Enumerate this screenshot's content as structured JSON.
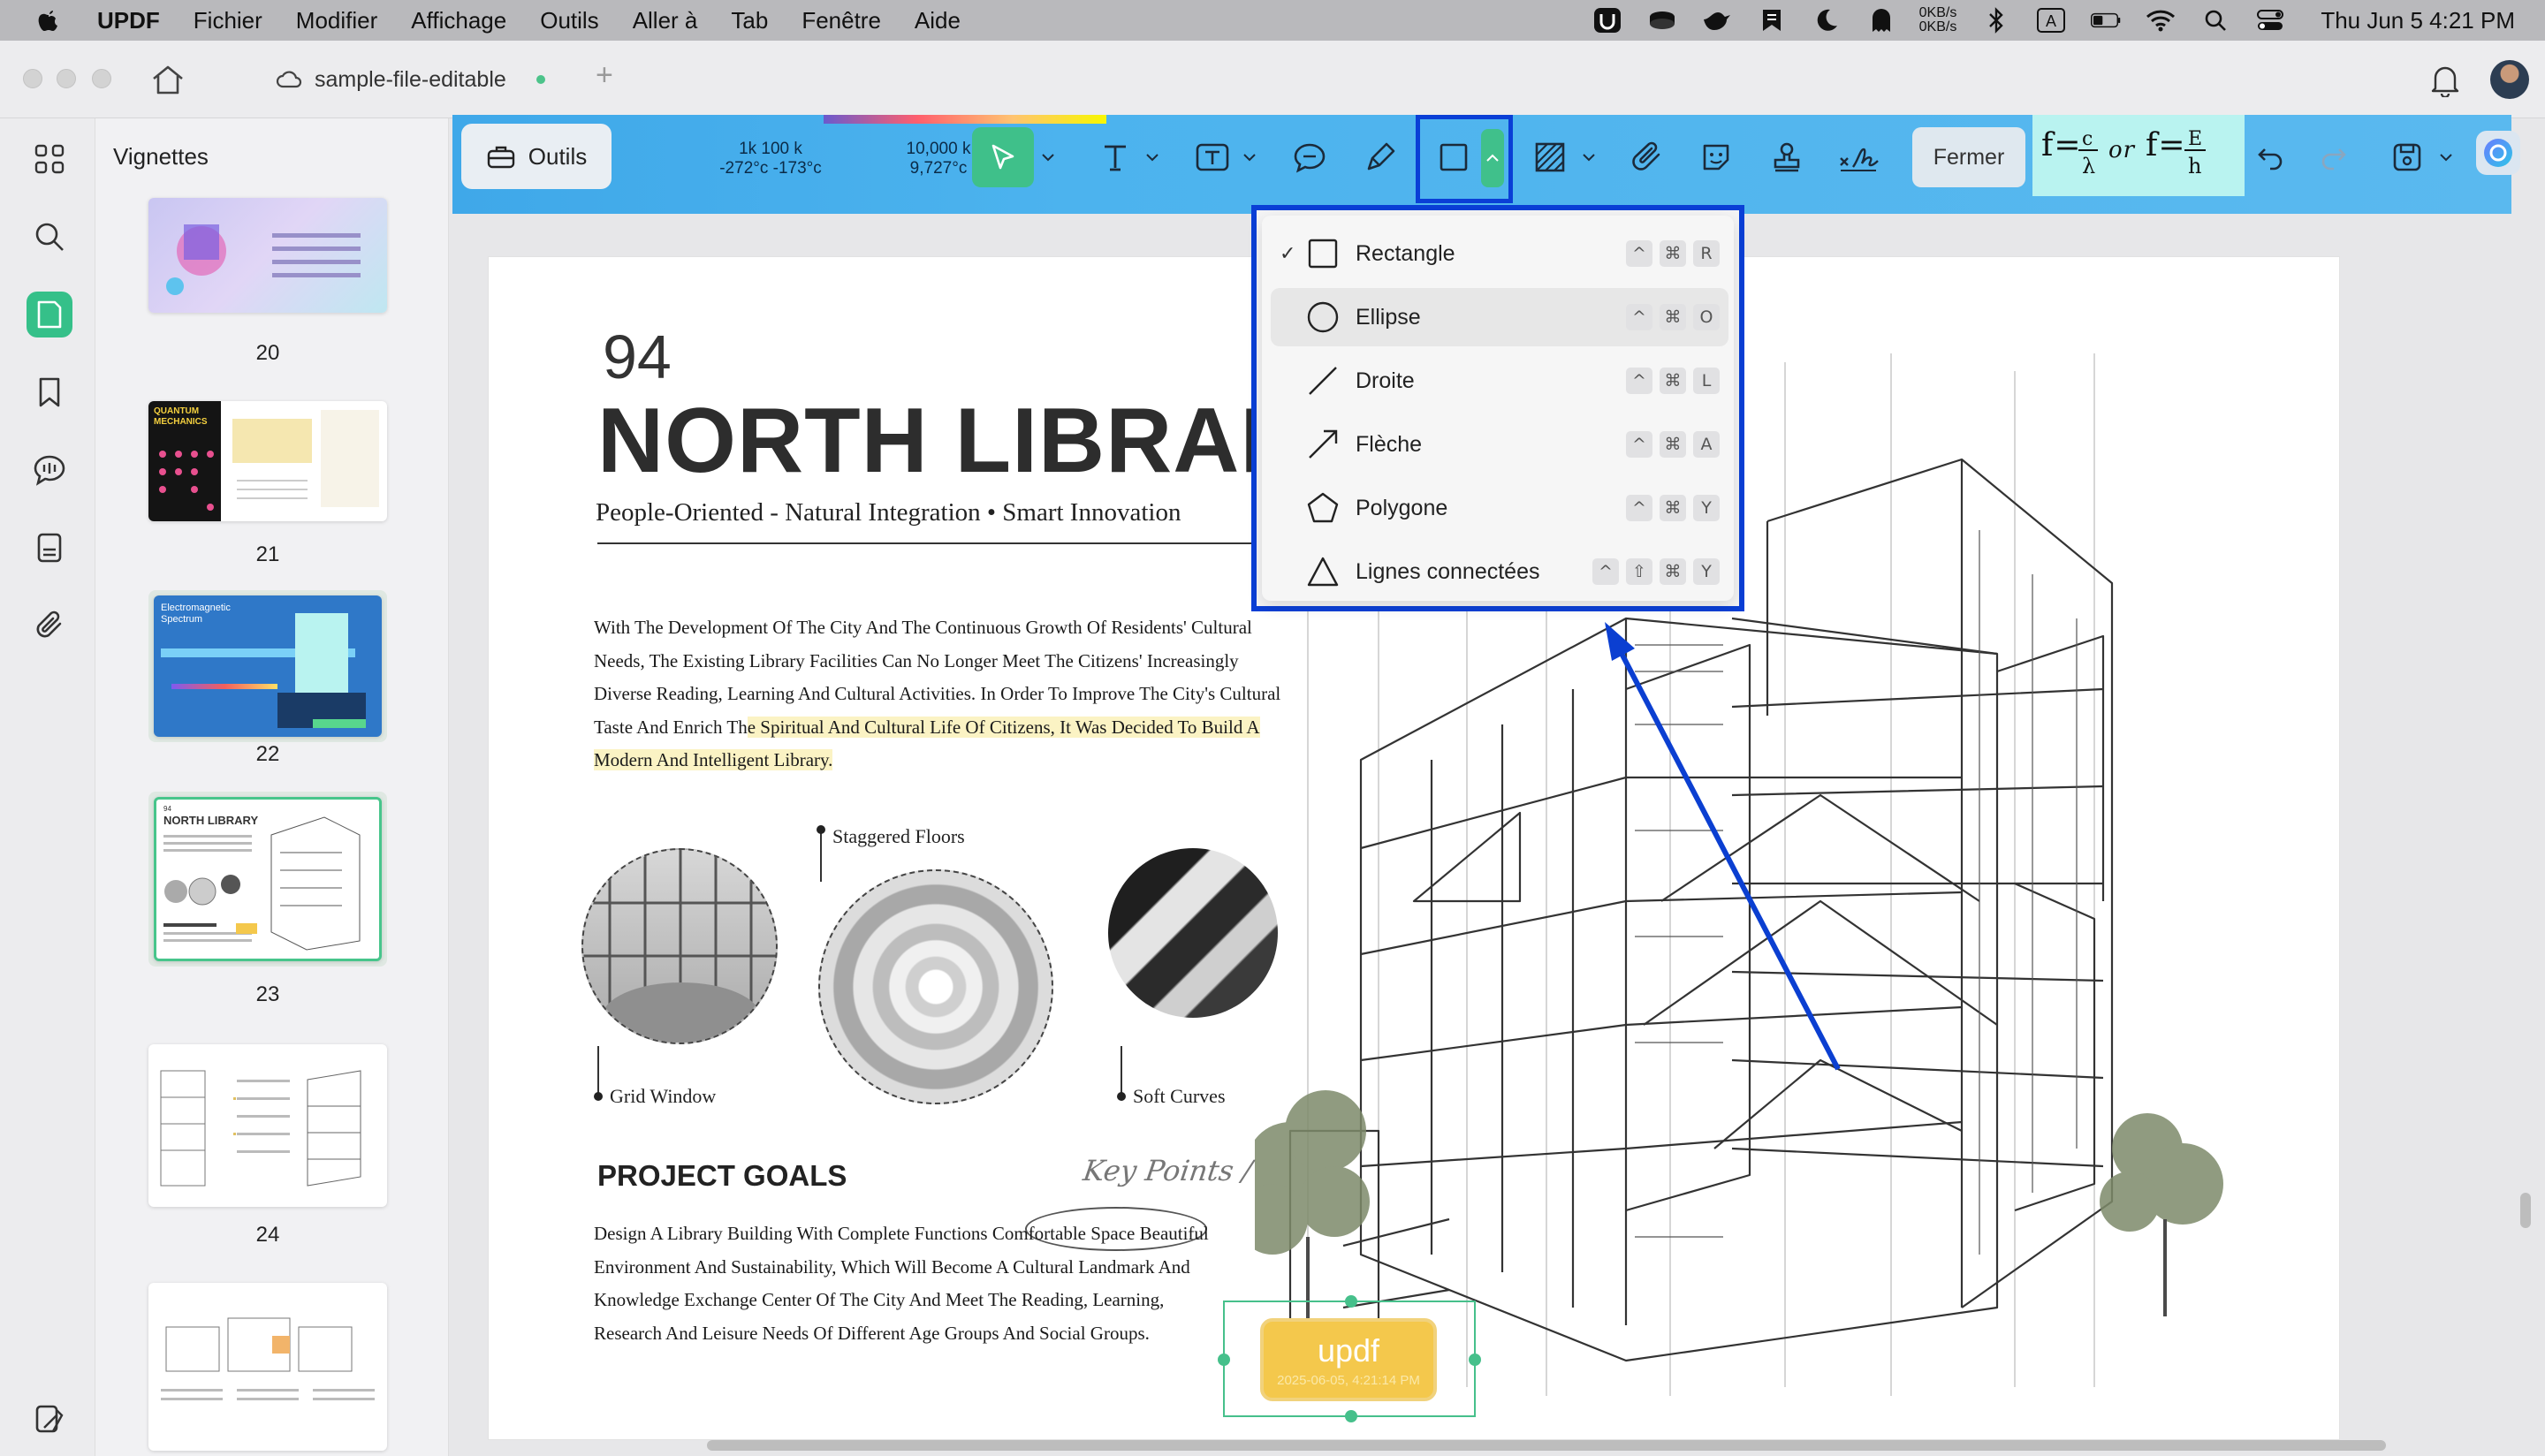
{
  "menubar": {
    "app_name": "UPDF",
    "items": [
      "Fichier",
      "Modifier",
      "Affichage",
      "Outils",
      "Aller à",
      "Tab",
      "Fenêtre",
      "Aide"
    ],
    "net_up": "0KB/s",
    "net_down": "0KB/s",
    "clock": "Thu Jun 5  4:21 PM"
  },
  "tabbar": {
    "doc_tab_title": "sample-file-editable",
    "add_tab": "+"
  },
  "thumbnails": {
    "panel_title": "Vignettes",
    "pages": [
      {
        "label": "20"
      },
      {
        "label": "21",
        "heading": "QUANTUM MECHANICS"
      },
      {
        "label": "22",
        "heading": "Electromagnetic Spectrum"
      },
      {
        "label": "23",
        "heading": "NORTH LIBRARY",
        "selected": true
      },
      {
        "label": "24"
      }
    ]
  },
  "toolbar": {
    "outils_label": "Outils",
    "fermer_label": "Fermer",
    "strip_labels": [
      {
        "line1": "1k 100 k",
        "line2": "-272°c   -173°c"
      },
      {
        "line1": "10,000 k",
        "line2": "9,727°c"
      }
    ],
    "formula": "f=c/λ or f=E/h"
  },
  "shape_menu": {
    "items": [
      {
        "label": "Rectangle",
        "checked": true,
        "keys": [
          "^",
          "⌘",
          "R"
        ],
        "icon": "rectangle-icon"
      },
      {
        "label": "Ellipse",
        "checked": false,
        "keys": [
          "^",
          "⌘",
          "O"
        ],
        "icon": "ellipse-icon"
      },
      {
        "label": "Droite",
        "checked": false,
        "keys": [
          "^",
          "⌘",
          "L"
        ],
        "icon": "line-icon"
      },
      {
        "label": "Flèche",
        "checked": false,
        "keys": [
          "^",
          "⌘",
          "A"
        ],
        "icon": "arrow-icon"
      },
      {
        "label": "Polygone",
        "checked": false,
        "keys": [
          "^",
          "⌘",
          "Y"
        ],
        "icon": "polygon-icon"
      },
      {
        "label": "Lignes connectées",
        "checked": false,
        "keys": [
          "^",
          "⇧",
          "⌘",
          "Y"
        ],
        "icon": "connected-lines-icon"
      }
    ],
    "check_mark": "✓"
  },
  "page": {
    "number": "94",
    "title": "NORTH LIBRARY",
    "subtitle": "People-Oriented - Natural Integration • Smart Innovation",
    "para1_normal": "With The Development Of The City And The Continuous Growth Of Residents' Cultural Needs, The Existing Library Facilities Can No Longer Meet The Citizens' Increasingly Diverse Reading, Learning And Cultural Activities. In Order To Improve The City's Cultural Taste And Enrich Th",
    "para1_highlight": "e Spiritual And Cultural Life Of Citizens, It Was Decided To Build A Modern And Intelligent Library.",
    "captions": {
      "grid_window": "Grid Window",
      "staggered_floors": "Staggered Floors",
      "soft_curves": "Soft Curves"
    },
    "goals_title": "PROJECT GOALS",
    "key_points": "Key Points /",
    "para2": "Design A Library Building With Complete Functions Comfortable Space Beautiful Environment And Sustainability, Which Will Become A Cultural Landmark And Knowledge Exchange Center Of The City And Meet The Reading, Learning, Research And Leisure Needs Of Different Age Groups And Social Groups.",
    "stamp_title": "updf",
    "stamp_date": "2025-06-05, 4:21:14 PM"
  },
  "colors": {
    "accent_green": "#3fc08a",
    "highlight_blue": "#0a3fd6",
    "strip_blue": "#4cb3ee"
  }
}
